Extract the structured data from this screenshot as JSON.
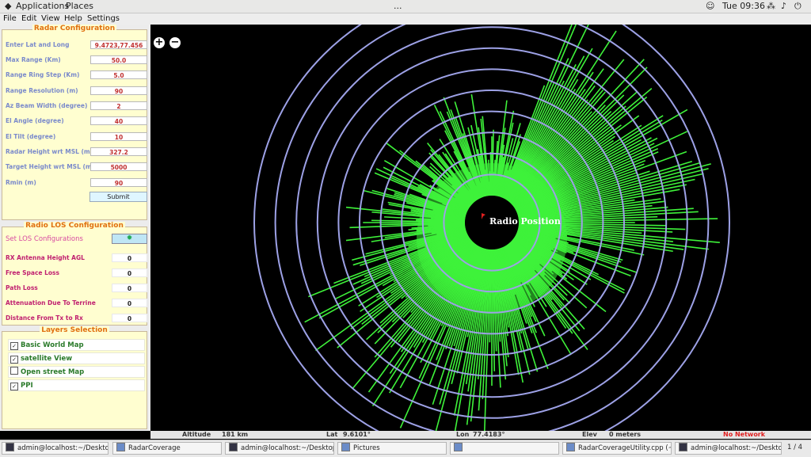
{
  "topbar": {
    "applications": "Applications",
    "places": "Places",
    "center": "...",
    "clock": "Tue 09:36",
    "pager": "1 / 4"
  },
  "menubar": {
    "items": [
      "File",
      "Edit",
      "View",
      "Help",
      "Settings"
    ]
  },
  "radar_config": {
    "title": "Radar Configuration",
    "fields": [
      {
        "label": "Enter Lat and Long",
        "value": "9.4723,77.456"
      },
      {
        "label": "Max Range (Km)",
        "value": "50.0"
      },
      {
        "label": "Range Ring Step (Km)",
        "value": "5.0"
      },
      {
        "label": "Range Resolution (m)",
        "value": "90"
      },
      {
        "label": "Az Beam Width (degree)",
        "value": "2"
      },
      {
        "label": "El Angle (degree)",
        "value": "40"
      },
      {
        "label": "El Tilt (degree)",
        "value": "10"
      },
      {
        "label": "Radar Height wrt MSL (m)",
        "value": "327.2"
      },
      {
        "label": "Target Height wrt MSL (m)",
        "value": "5000"
      },
      {
        "label": "Rmin (m)",
        "value": "90"
      }
    ],
    "submit_label": "Submit"
  },
  "radio_los": {
    "title": "Radio LOS Configuration",
    "set_label": "Set LOS Configurations",
    "rows": [
      {
        "label": "RX Antenna Height AGL",
        "value": "0"
      },
      {
        "label": "Free Space Loss",
        "value": "0"
      },
      {
        "label": "Path Loss",
        "value": "0"
      },
      {
        "label": "Attenuation Due To Terrine",
        "value": "0"
      },
      {
        "label": "Distance From Tx to Rx",
        "value": "0"
      }
    ]
  },
  "layers": {
    "title": "Layers Selection",
    "items": [
      {
        "label": "Basic World Map",
        "checked": true
      },
      {
        "label": "satellite View",
        "checked": true
      },
      {
        "label": "Open street Map",
        "checked": false
      },
      {
        "label": "PPI",
        "checked": true
      }
    ]
  },
  "map": {
    "radar_label": "Radio Position",
    "zoom_in": "+",
    "zoom_out": "−",
    "ring_color": "#9da1e6",
    "coverage_color": "#3ef23a"
  },
  "status": {
    "altitude_label": "Altitude",
    "altitude_value": "181 km",
    "lat_label": "Lat",
    "lat_value": "9.6101°",
    "lon_label": "Lon",
    "lon_value": "77.4183°",
    "elev_label": "Elev",
    "elev_value": "0 meters",
    "network": "No Network"
  },
  "taskbar": {
    "items": [
      "admin@localhost:~/Desktop...",
      "RadarCoverage",
      "admin@localhost:~/Desktop...",
      "Pictures",
      "",
      "RadarCoverageUtility.cpp (~/...",
      "admin@localhost:~/Desktop..."
    ]
  }
}
